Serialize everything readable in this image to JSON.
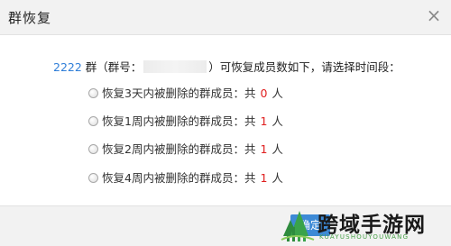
{
  "dialog": {
    "title": "群恢复",
    "close_glyph": "×"
  },
  "description": {
    "group_count": "2222",
    "text_before_id": " 群（群号：",
    "text_after_id": "）可恢复成员数如下，请选择时间段："
  },
  "options": [
    {
      "label": "恢复3天内被删除的群成员：共",
      "count": "0",
      "unit": "人"
    },
    {
      "label": "恢复1周内被删除的群成员：共",
      "count": "1",
      "unit": "人"
    },
    {
      "label": "恢复2周内被删除的群成员：共",
      "count": "1",
      "unit": "人"
    },
    {
      "label": "恢复4周内被删除的群成员：共",
      "count": "1",
      "unit": "人"
    }
  ],
  "footer": {
    "confirm_label": "确定"
  },
  "watermark": {
    "name": "跨域手游网",
    "sub": "KUAYUSHOUYOUWANG"
  },
  "colors": {
    "accent_blue": "#2f7ed8",
    "count_red": "#e02020",
    "button_blue": "#3d8ad6",
    "watermark_green": "#4aa34a"
  }
}
